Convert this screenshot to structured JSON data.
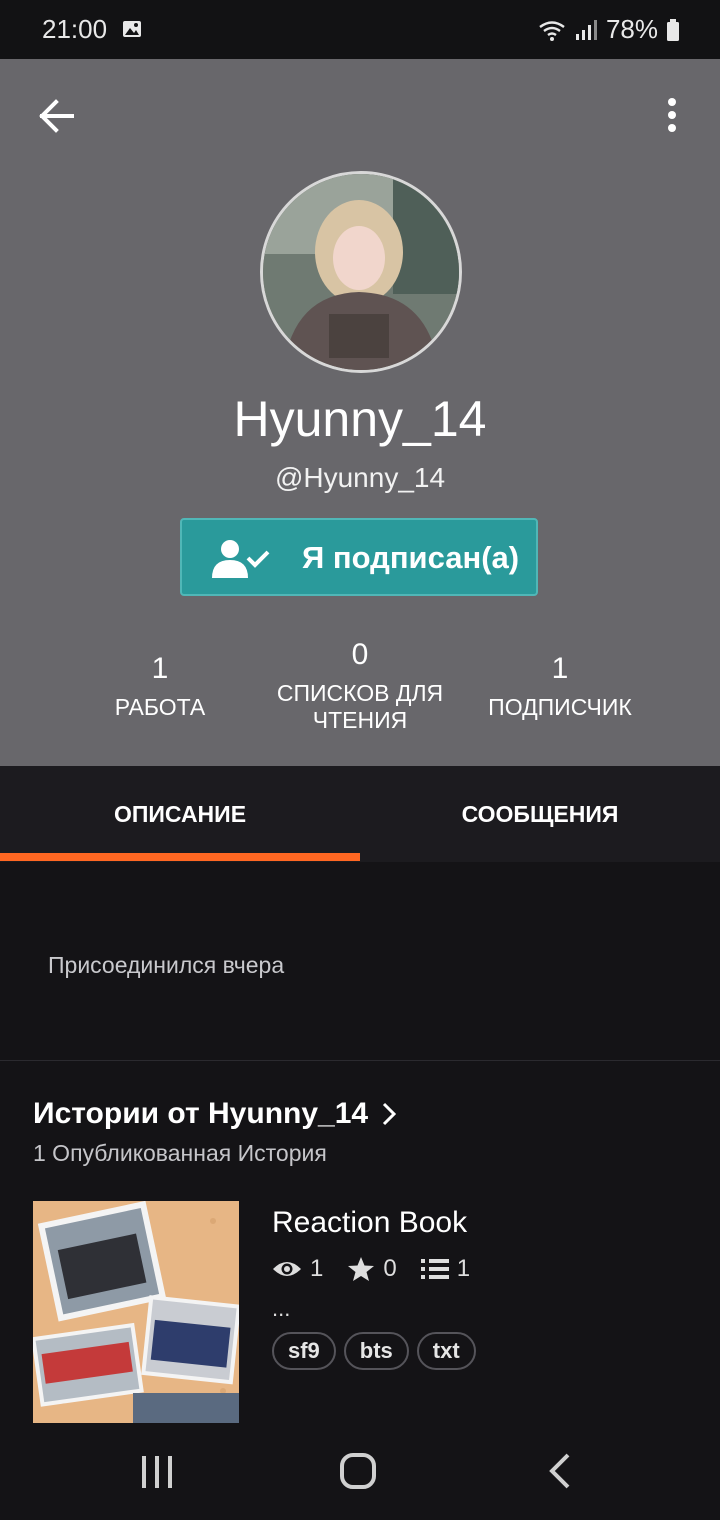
{
  "status_bar": {
    "time": "21:00",
    "battery": "78%"
  },
  "profile": {
    "display_name": "Hyunny_14",
    "username": "@Hyunny_14",
    "follow_button": "Я подписан(а)"
  },
  "stats": [
    {
      "value": "1",
      "label": "РАБОТА"
    },
    {
      "value": "0",
      "label_line1": "СПИСКОВ ДЛЯ",
      "label_line2": "ЧТЕНИЯ"
    },
    {
      "value": "1",
      "label": "ПОДПИСЧИК"
    }
  ],
  "tabs": {
    "about": "ОПИСАНИЕ",
    "messages": "СООБЩЕНИЯ"
  },
  "about": {
    "joined": "Присоединился вчера"
  },
  "stories": {
    "title": "Истории от Hyunny_14",
    "subtitle": "1 Опубликованная История",
    "items": [
      {
        "title": "Reaction Book",
        "reads": "1",
        "votes": "0",
        "parts": "1",
        "description": "...",
        "tags": [
          "sf9",
          "bts",
          "txt"
        ]
      }
    ]
  },
  "colors": {
    "accent_tab": "#ff6722",
    "follow_button": "#2a9a9b",
    "header_bg": "#68676b"
  },
  "icons": [
    "gallery-icon",
    "wifi-icon",
    "signal-icon",
    "battery-icon",
    "back-arrow-icon",
    "more-vert-icon",
    "user-check-icon",
    "chevron-right-icon",
    "eye-icon",
    "star-icon",
    "list-icon",
    "recent-apps-icon",
    "home-icon",
    "nav-back-icon"
  ]
}
